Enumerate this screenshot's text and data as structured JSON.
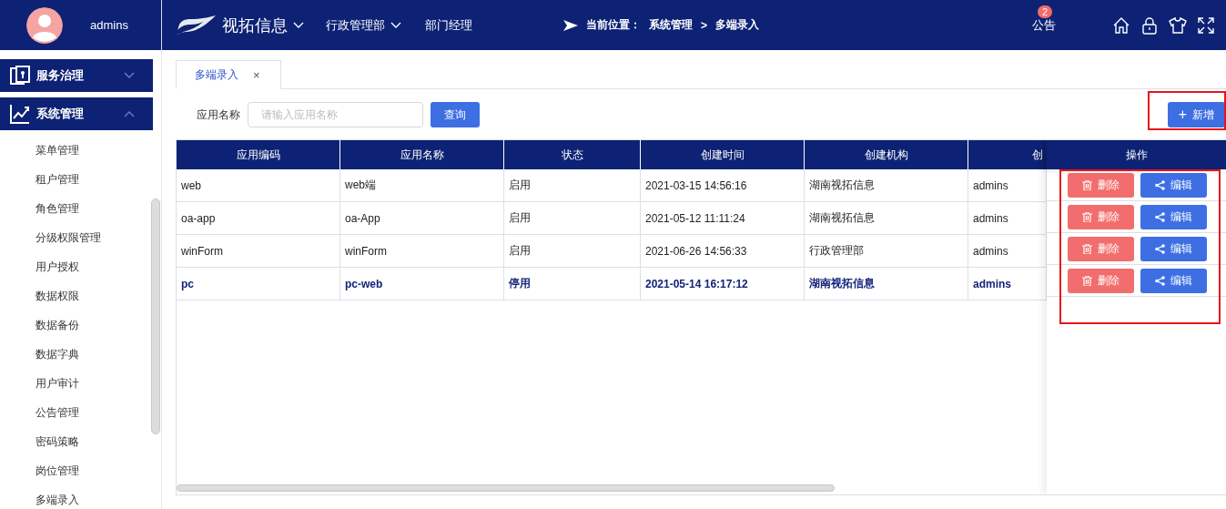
{
  "user": {
    "name": "admins"
  },
  "topbar": {
    "company": "视拓信息",
    "department": "行政管理部",
    "role": "部门经理",
    "breadcrumb": {
      "label": "当前位置：",
      "items": [
        "系统管理",
        "多端录入"
      ],
      "separator": ">"
    },
    "notice": {
      "label": "公告",
      "badge": "2"
    }
  },
  "sidebar": {
    "groups": [
      {
        "label": "服务治理",
        "kind": "doc",
        "expanded": false
      },
      {
        "label": "系统管理",
        "kind": "chart",
        "expanded": true,
        "children": [
          "菜单管理",
          "租户管理",
          "角色管理",
          "分级权限管理",
          "用户授权",
          "数据权限",
          "数据备份",
          "数据字典",
          "用户审计",
          "公告管理",
          "密码策略",
          "岗位管理",
          "多端录入"
        ]
      }
    ]
  },
  "tabs": [
    {
      "label": "多端录入",
      "selected": true,
      "close": "×"
    }
  ],
  "search": {
    "label": "应用名称",
    "placeholder": "请输入应用名称",
    "button": "查询"
  },
  "add_button": {
    "icon": "+",
    "label": "新增"
  },
  "table": {
    "columns": [
      "应用编码",
      "应用名称",
      "状态",
      "创建时间",
      "创建机构",
      "创"
    ],
    "action_column": "操作",
    "rows": [
      {
        "cells": [
          "web",
          "web端",
          "启用",
          "2021-03-15 14:56:16",
          "湖南视拓信息",
          "admins"
        ],
        "selected": false,
        "actions": [
          "删除",
          "编辑"
        ]
      },
      {
        "cells": [
          "oa-app",
          "oa-App",
          "启用",
          "2021-05-12 11:11:24",
          "湖南视拓信息",
          "admins"
        ],
        "selected": false,
        "actions": [
          "删除",
          "编辑"
        ]
      },
      {
        "cells": [
          "winForm",
          "winForm",
          "启用",
          "2021-06-26 14:56:33",
          "行政管理部",
          "admins"
        ],
        "selected": false,
        "actions": [
          "删除",
          "编辑"
        ]
      },
      {
        "cells": [
          "pc",
          "pc-web",
          "停用",
          "2021-05-14 16:17:12",
          "湖南视拓信息",
          "admins"
        ],
        "selected": true,
        "actions": [
          "删除",
          "编辑"
        ]
      }
    ]
  }
}
